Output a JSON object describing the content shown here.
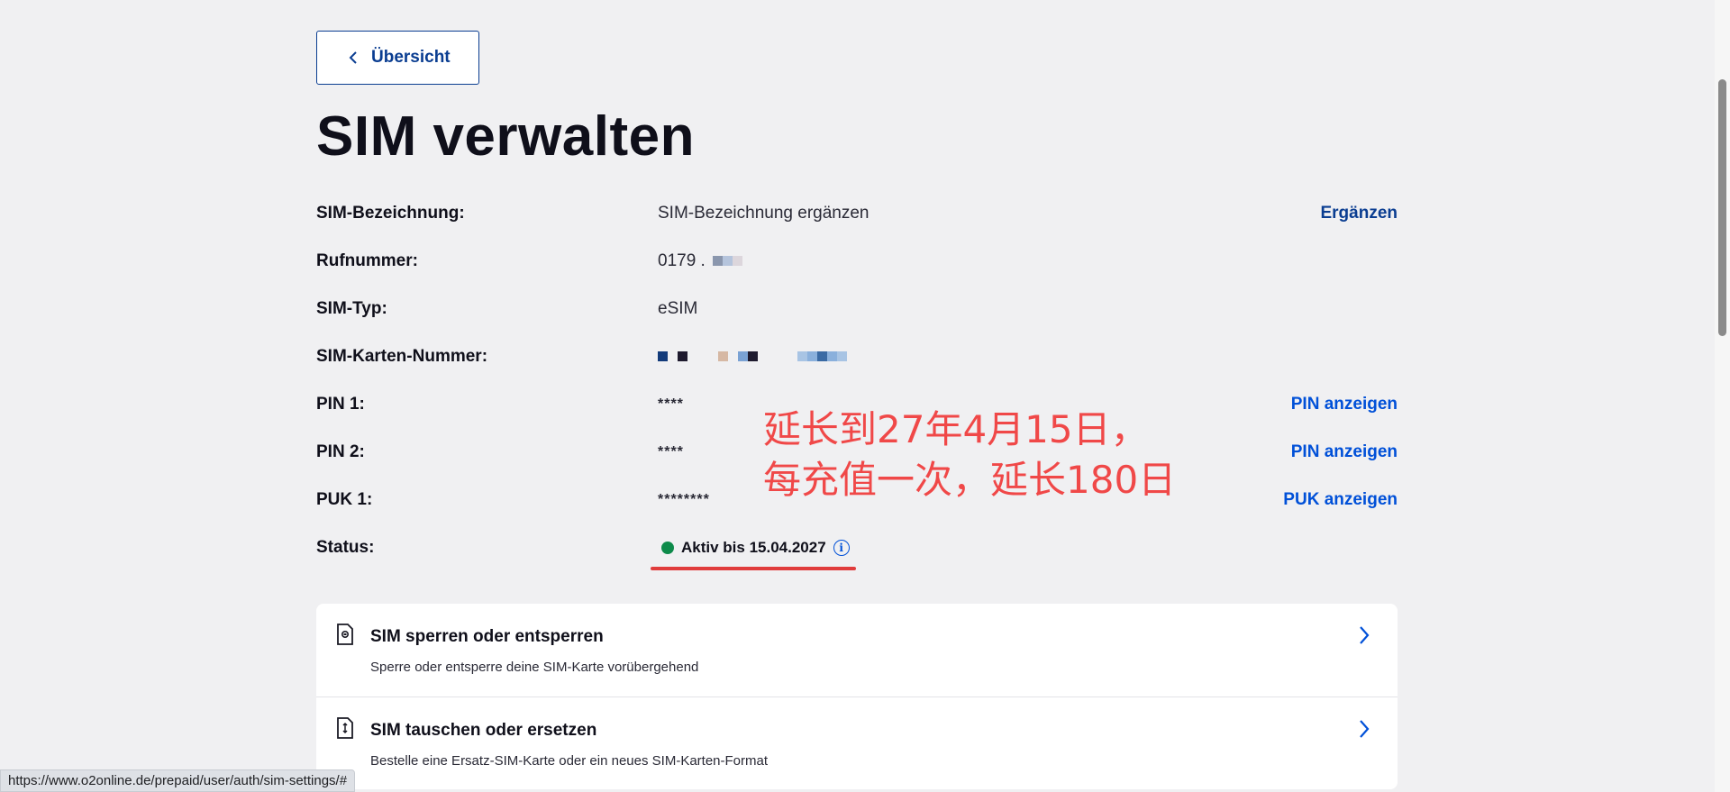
{
  "back_button": {
    "label": "Übersicht"
  },
  "page_title": "SIM verwalten",
  "rows": {
    "name": {
      "label": "SIM-Bezeichnung:",
      "value": "SIM-Bezeichnung ergänzen",
      "action": "Ergänzen"
    },
    "phone": {
      "label": "Rufnummer:",
      "value": "0179 ."
    },
    "type": {
      "label": "SIM-Typ:",
      "value": "eSIM"
    },
    "card_number": {
      "label": "SIM-Karten-Nummer:"
    },
    "pin1": {
      "label": "PIN 1:",
      "value": "****",
      "action": "PIN anzeigen"
    },
    "pin2": {
      "label": "PIN 2:",
      "value": "****",
      "action": "PIN anzeigen"
    },
    "puk1": {
      "label": "PUK 1:",
      "value": "********",
      "action": "PUK anzeigen"
    },
    "status": {
      "label": "Status:",
      "value": "Aktiv bis 15.04.2027",
      "info_glyph": "i"
    }
  },
  "annotation": {
    "line1": "延长到27年4月15日，",
    "line2": "每充值一次，延长180日"
  },
  "cards": [
    {
      "title": "SIM sperren oder entsperren",
      "description": "Sperre oder entsperre deine SIM-Karte vorübergehend",
      "icon": "sim-lock-icon"
    },
    {
      "title": "SIM tauschen oder ersetzen",
      "description": "Bestelle eine Ersatz-SIM-Karte oder ein neues SIM-Karten-Format",
      "icon": "sim-swap-icon"
    }
  ],
  "status_url": "https://www.o2online.de/prepaid/user/auth/sim-settings/#",
  "colors": {
    "link_blue": "#0050d8",
    "dark_blue": "#0a3d91",
    "status_green": "#0d8a4a",
    "annotation_red": "#f04848"
  }
}
